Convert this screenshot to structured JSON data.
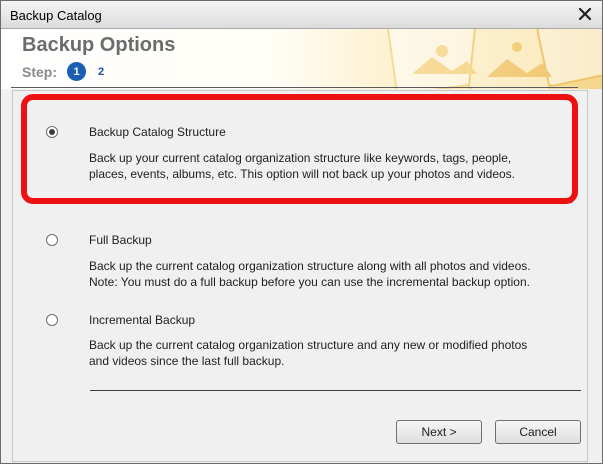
{
  "window": {
    "title": "Backup Catalog",
    "close_glyph": "✕"
  },
  "header": {
    "heading": "Backup Options",
    "step_label": "Step:",
    "steps": [
      {
        "label": "1",
        "active": true
      },
      {
        "label": "2",
        "active": false
      }
    ]
  },
  "options": [
    {
      "title": "Backup Catalog Structure",
      "selected": true,
      "description": [
        "Back up your current catalog organization structure like keywords, tags, people,",
        "places, events, albums, etc. This option will not back up your photos and videos."
      ]
    },
    {
      "title": "Full Backup",
      "selected": false,
      "description": [
        "Back up the current catalog organization structure along with all photos and videos.",
        "Note: You must do a full backup before you can use the incremental backup option."
      ]
    },
    {
      "title": "Incremental Backup",
      "selected": false,
      "description": [
        "Back up the current catalog organization structure and any new or modified photos",
        "and videos since the last full backup."
      ]
    }
  ],
  "buttons": {
    "next": "Next >",
    "cancel": "Cancel"
  },
  "colors": {
    "highlight": "#ee1111",
    "step_active": "#1a5fb4"
  }
}
